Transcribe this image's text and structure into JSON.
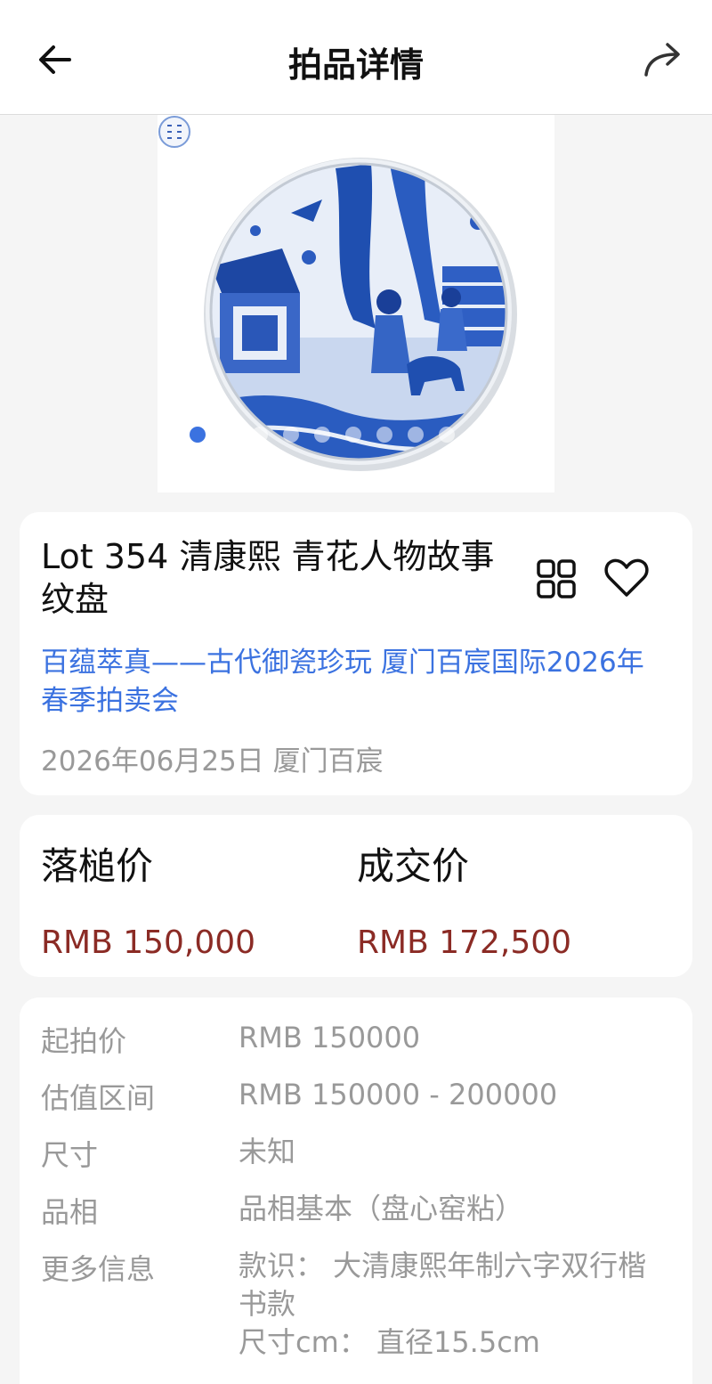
{
  "header": {
    "title": "拍品详情",
    "back_icon": "arrow-left-icon",
    "share_icon": "share-arrow-icon"
  },
  "gallery": {
    "image": "blue-and-white porcelain plate with figures, crane and deer",
    "page_count": 11,
    "active_index": 0,
    "seal_icon": "reign-mark-seal-icon"
  },
  "lot": {
    "title": "Lot 354 清康熙 青花人物故事纹盘",
    "sale_name": "百蕴萃真——古代御瓷珍玩 厦门百宸国际2026年春季拍卖会",
    "meta": "2026年06月25日 厦门百宸",
    "grid_icon": "grid-icon",
    "favorite_icon": "heart-icon"
  },
  "prices": {
    "hammer_label": "落槌价",
    "hammer_value": "RMB 150,000",
    "final_label": "成交价",
    "final_value": "RMB 172,500"
  },
  "details": [
    {
      "label": "起拍价",
      "value": "RMB 150000"
    },
    {
      "label": "估值区间",
      "value": "RMB 150000 - 200000"
    },
    {
      "label": "尺寸",
      "value": "未知"
    },
    {
      "label": "品相",
      "value": "品相基本（盘心窑粘）"
    },
    {
      "label": "更多信息",
      "value": "款识：  大清康熙年制六字双行楷书款\n尺寸cm：  直径15.5cm"
    }
  ],
  "colors": {
    "accent": "#3b72e0",
    "price": "#8b2b25",
    "muted": "#999999",
    "porcelain_blue": "#1f4fb0"
  }
}
